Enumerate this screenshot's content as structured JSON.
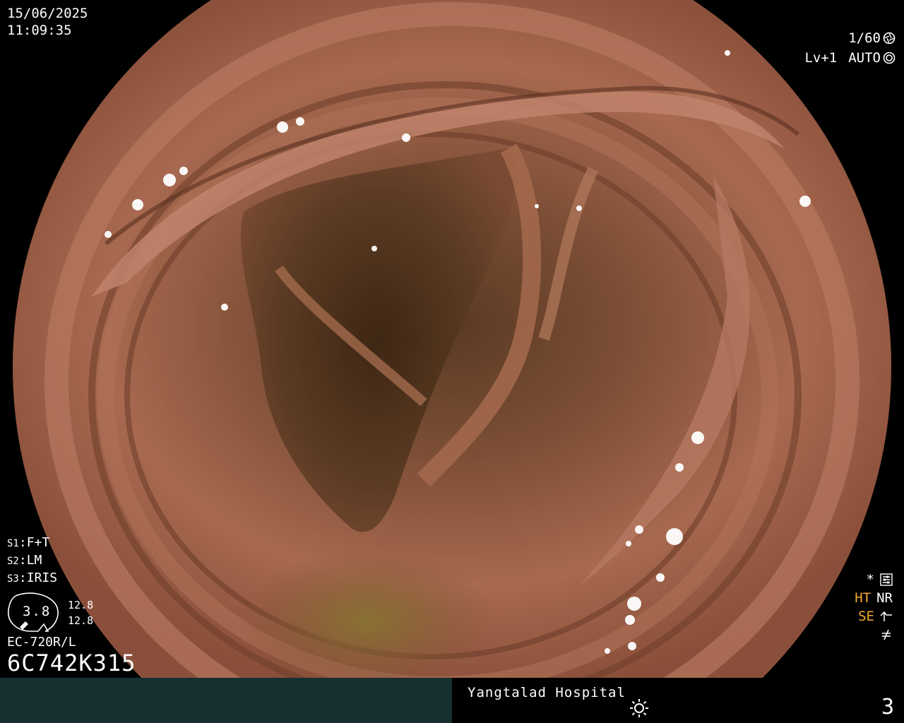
{
  "overlay": {
    "date": "15/06/2025",
    "time": "11:09:35",
    "shutter_speed": "1/60",
    "level": "Lv+1",
    "exposure_mode": "AUTO",
    "settings": [
      {
        "key": "S1",
        "value": "F+T"
      },
      {
        "key": "S2",
        "value": "LM"
      },
      {
        "key": "S3",
        "value": "IRIS"
      }
    ],
    "iris_value": "3.8",
    "iris_readouts": [
      "12.8",
      "12.8"
    ],
    "scope_model": "EC-720R/L",
    "scope_serial": "6C742K315",
    "right_labels": {
      "asterisk": "*",
      "ht": "HT",
      "nr": "NR",
      "se": "SE"
    }
  },
  "footer": {
    "hospital": "Yangtalad Hospital",
    "page_number": "3"
  },
  "icons": {
    "shutter": "aperture-icon",
    "auto": "iris-ring-icon",
    "settings": "menu-settings-icon",
    "se": "edge-enhance-icon",
    "not_equal": "not-equal-icon",
    "sun": "sun-icon",
    "scope_tip": "scope-tip-icon"
  },
  "colors": {
    "background": "#000000",
    "footer_left": "#16302f",
    "mucosa": "#a56a4e",
    "label_orange": "#f7a833",
    "overlay_text": "#ffffff"
  }
}
